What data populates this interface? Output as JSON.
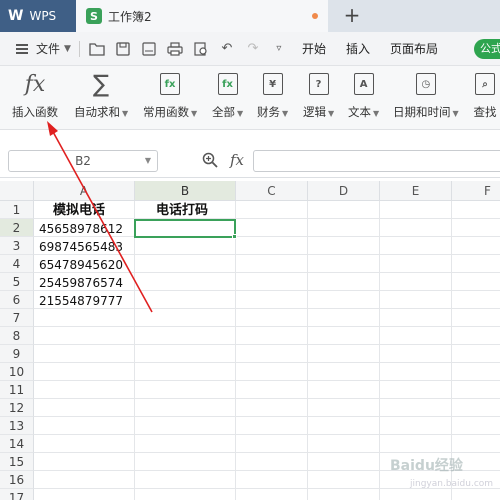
{
  "tabbar": {
    "app_label": "WPS",
    "doc_title": "工作簿2",
    "new_tab": "+"
  },
  "menubar": {
    "file_label": "文件",
    "items": [
      "开始",
      "插入",
      "页面布局"
    ],
    "overflow_label": "公式"
  },
  "ribbon": {
    "buttons": [
      {
        "label": "插入函数",
        "icon": "fx-icon",
        "caret": false
      },
      {
        "label": "自动求和",
        "icon": "sigma-icon",
        "caret": true
      },
      {
        "label": "常用函数",
        "icon": "star-fx-icon",
        "caret": true
      },
      {
        "label": "全部",
        "icon": "fx-box-icon",
        "caret": true
      },
      {
        "label": "财务",
        "icon": "yen-icon",
        "caret": true
      },
      {
        "label": "逻辑",
        "icon": "question-icon",
        "caret": true
      },
      {
        "label": "文本",
        "icon": "text-a-icon",
        "caret": true
      },
      {
        "label": "日期和时间",
        "icon": "clock-icon",
        "caret": true
      },
      {
        "label": "查找",
        "icon": "search-icon",
        "caret": false
      }
    ]
  },
  "formula_bar": {
    "name_box": "B2",
    "fx_label": "fx",
    "formula": ""
  },
  "sheet": {
    "columns": [
      "A",
      "B",
      "C",
      "D",
      "E",
      "F"
    ],
    "rows": [
      "1",
      "2",
      "3",
      "4",
      "5",
      "6",
      "7",
      "8",
      "9",
      "10",
      "11",
      "12",
      "13",
      "14",
      "15",
      "16",
      "17"
    ],
    "cells": {
      "A1": "模拟电话",
      "B1": "电话打码",
      "A2": "45658978612",
      "A3": "69874565483",
      "A4": "65478945620",
      "A5": "25459876574",
      "A6": "21554879777"
    },
    "active_cell": "B2"
  },
  "watermark": {
    "text": "Baidu经验",
    "sub": "jingyan.baidu.com"
  },
  "colors": {
    "accent_green": "#3aa15a",
    "annotation_red": "#e02020",
    "tab_blue": "#3f5f86"
  }
}
